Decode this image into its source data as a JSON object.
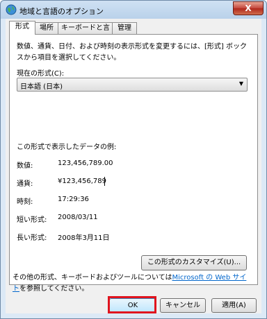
{
  "window": {
    "title": "地域と言語のオプション",
    "close_label": "X"
  },
  "tabs": [
    {
      "label": "形式",
      "active": true
    },
    {
      "label": "場所",
      "active": false
    },
    {
      "label": "キーボードと言語",
      "active": false
    },
    {
      "label": "管理",
      "active": false
    }
  ],
  "format": {
    "description": "数値、通貨、日付、および時刻の表示形式を変更するには、[形式] ボックスから項目を選択してください。",
    "current_label": "現在の形式(C):",
    "current_value": "日本語 (日本)",
    "sample_title": "この形式で表示したデータの例:",
    "samples": [
      {
        "label": "数値:",
        "value": "123,456,789.00"
      },
      {
        "label": "通貨:",
        "value": "¥123,456,789"
      },
      {
        "label": "時刻:",
        "value": "17:29:36"
      },
      {
        "label": "短い形式:",
        "value": "2008/03/11"
      },
      {
        "label": "長い形式:",
        "value": "2008年3月11日"
      }
    ],
    "customize_label": "この形式のカスタマイズ(U)..."
  },
  "note": {
    "prefix": "その他の形式、キーボードおよびツールについては",
    "link": "Microsoft の Web サイト",
    "suffix": "を参照してください。"
  },
  "buttons": {
    "ok": "OK",
    "cancel": "キャンセル",
    "apply": "適用(A)"
  },
  "colors": {
    "highlight": "#e0141e",
    "link": "#0066cc"
  }
}
